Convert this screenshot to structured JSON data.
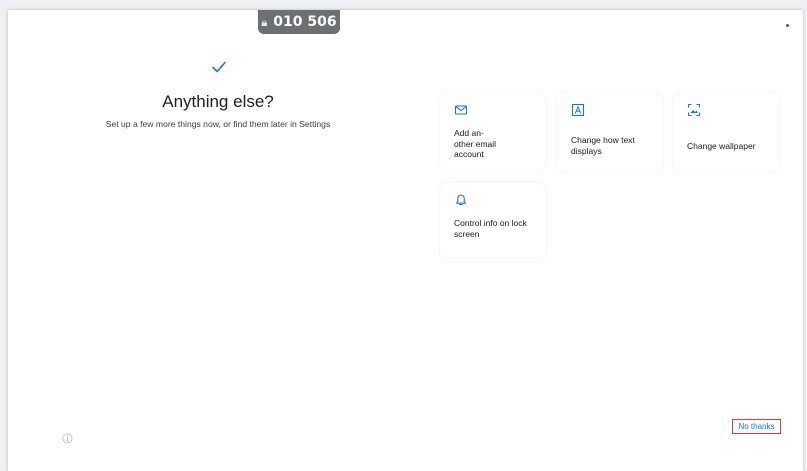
{
  "header": {
    "code_badge": "010 506"
  },
  "main": {
    "title": "Anything else?",
    "subtitle": "Set up a few more things now, or find them later in Settings"
  },
  "options": [
    {
      "label": "Add an-\nother email\naccount",
      "icon": "mail-icon"
    },
    {
      "label": "Change how text displays",
      "icon": "text-display-icon"
    },
    {
      "label": "Change wallpaper",
      "icon": "wallpaper-icon"
    },
    {
      "label": "Control info on lock screen",
      "icon": "bell-icon"
    }
  ],
  "footer": {
    "no_thanks_label": "No thanks"
  },
  "colors": {
    "accent": "#1a73e8",
    "highlight_border": "#e53935",
    "badge_bg": "#6d7073"
  }
}
